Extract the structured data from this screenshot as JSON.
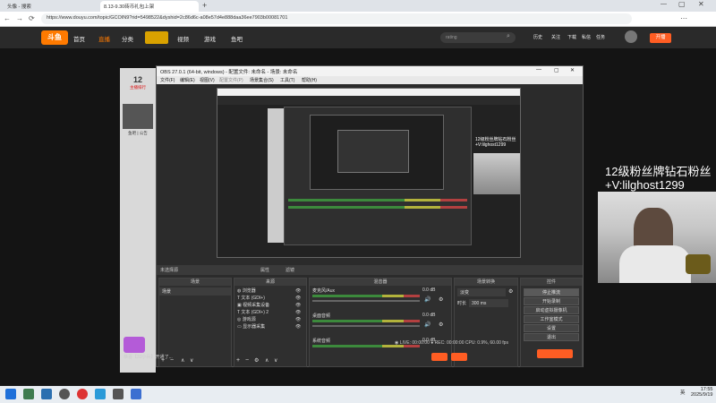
{
  "browser": {
    "tabs": [
      "头像 - 搜索",
      "8.13-9.30砖币礼包上架"
    ],
    "url": "https://www.douyu.com/topic/GCOIN9?rid=5498522&dyshid=2c86d6c-a08e57d4e888daa36ee7903b00081701"
  },
  "site": {
    "logo": "斗鱼",
    "nav": [
      "首页",
      "直播",
      "分类",
      "视频",
      "游戏",
      "鱼吧"
    ],
    "search_placeholder": "rating",
    "header_icons": [
      "历史",
      "关注",
      "下载",
      "私信",
      "任务",
      "开播"
    ],
    "start_live": "开播"
  },
  "sidebar": {
    "rank_number": "12",
    "rank_label": "主播排行",
    "author_name": "鱼吧 | 公告"
  },
  "obs": {
    "title": "OBS 27.0.1 (64-bit, windows) - 配置文件: 未命名 - 场景: 未命名",
    "menu": [
      "文件(F)",
      "编辑(E)",
      "视图(V)",
      "配置文件(P)",
      "场景集合(S)",
      "工具(T)",
      "帮助(H)"
    ],
    "scene_bar": {
      "status": "未选择源",
      "properties": "属性",
      "filters": "滤镜"
    },
    "docks": {
      "scenes": {
        "title": "场景",
        "items": [
          "场景"
        ]
      },
      "sources": {
        "title": "来源",
        "items": [
          "浏览器",
          "文本 (GDI+)",
          "视频采集设备",
          "文本 (GDI+) 2",
          "游戏源",
          "显示器采集"
        ]
      },
      "mixer": {
        "title": "混音器",
        "tracks": [
          {
            "name": "麦克风/Aux",
            "db": "0.0 dB"
          },
          {
            "name": "桌面音频",
            "db": "0.0 dB"
          },
          {
            "name": "系统音频",
            "db": "0.0 dB"
          }
        ]
      },
      "transitions": {
        "title": "场景转换",
        "type": "淡变",
        "duration_label": "时长",
        "duration": "300 ms"
      },
      "controls": {
        "title": "控件",
        "buttons": [
          "停止推流",
          "开始录制",
          "启动虚拟摄像机",
          "工作室模式",
          "设置",
          "退出"
        ]
      }
    },
    "status": {
      "live": "LIVE: 00:00:00",
      "rec": "REC: 00:00:00",
      "cpu": "CPU: 0.9%, 60.00 fps"
    }
  },
  "overlay": {
    "line1": "12级粉丝牌钻石粉丝",
    "line2": "+V:lilghost1299"
  },
  "chat": {
    "message": "恭喜【33小兵】开通了..."
  },
  "taskbar": {
    "time": "17:55",
    "date": "2025/9/19",
    "lang": "英"
  }
}
